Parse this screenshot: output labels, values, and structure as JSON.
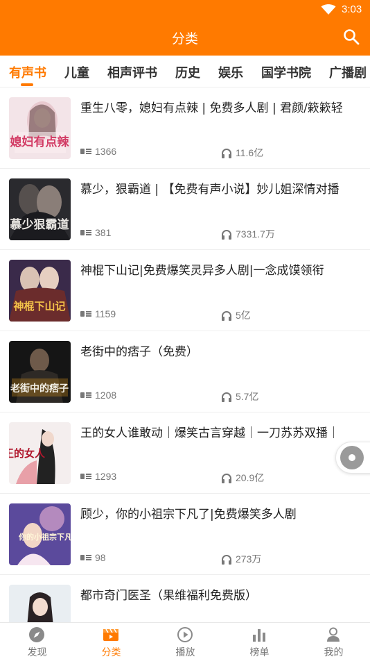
{
  "status_bar": {
    "time": "3:03"
  },
  "app_bar": {
    "title": "分类",
    "search_icon": "search-icon"
  },
  "tabs": [
    {
      "label": "有声书",
      "active": true
    },
    {
      "label": "儿童",
      "active": false
    },
    {
      "label": "相声评书",
      "active": false
    },
    {
      "label": "历史",
      "active": false
    },
    {
      "label": "娱乐",
      "active": false
    },
    {
      "label": "国学书院",
      "active": false
    },
    {
      "label": "广播剧",
      "active": false
    }
  ],
  "books": [
    {
      "title": "重生八零，媳妇有点辣 | 免费多人剧 | 君颜/簌簌轻",
      "episodes": "1366",
      "plays": "11.6亿",
      "cover_text": "媳妇有点辣"
    },
    {
      "title": "慕少，狠霸道 | 【免费有声小说】妙儿姐深情对播",
      "episodes": "381",
      "plays": "7331.7万",
      "cover_text": "慕少狠霸道"
    },
    {
      "title": "神棍下山记|免费爆笑灵异多人剧|一念成馍领衔",
      "episodes": "1159",
      "plays": "5亿",
      "cover_text": "神棍下山记"
    },
    {
      "title": "老街中的痞子（免费）",
      "episodes": "1208",
      "plays": "5.7亿",
      "cover_text": "老街中的痞子"
    },
    {
      "title": "王的女人谁敢动｜爆笑古言穿越｜一刀苏苏双播｜",
      "episodes": "1293",
      "plays": "20.9亿",
      "cover_text": "王的女人"
    },
    {
      "title": "顾少，你的小祖宗下凡了|免费爆笑多人剧",
      "episodes": "98",
      "plays": "273万",
      "cover_text": "你的小祖宗下凡了"
    },
    {
      "title": "都市奇门医圣（果维福利免费版）",
      "episodes": "",
      "plays": "",
      "cover_text": ""
    }
  ],
  "bottom_nav": [
    {
      "label": "发现",
      "icon": "compass-icon",
      "active": false
    },
    {
      "label": "分类",
      "icon": "category-icon",
      "active": true
    },
    {
      "label": "播放",
      "icon": "play-circle-icon",
      "active": false
    },
    {
      "label": "榜单",
      "icon": "bar-chart-icon",
      "active": false
    },
    {
      "label": "我的",
      "icon": "user-icon",
      "active": false
    }
  ],
  "colors": {
    "accent": "#ff7a00",
    "text": "#222222",
    "meta": "#777777"
  }
}
